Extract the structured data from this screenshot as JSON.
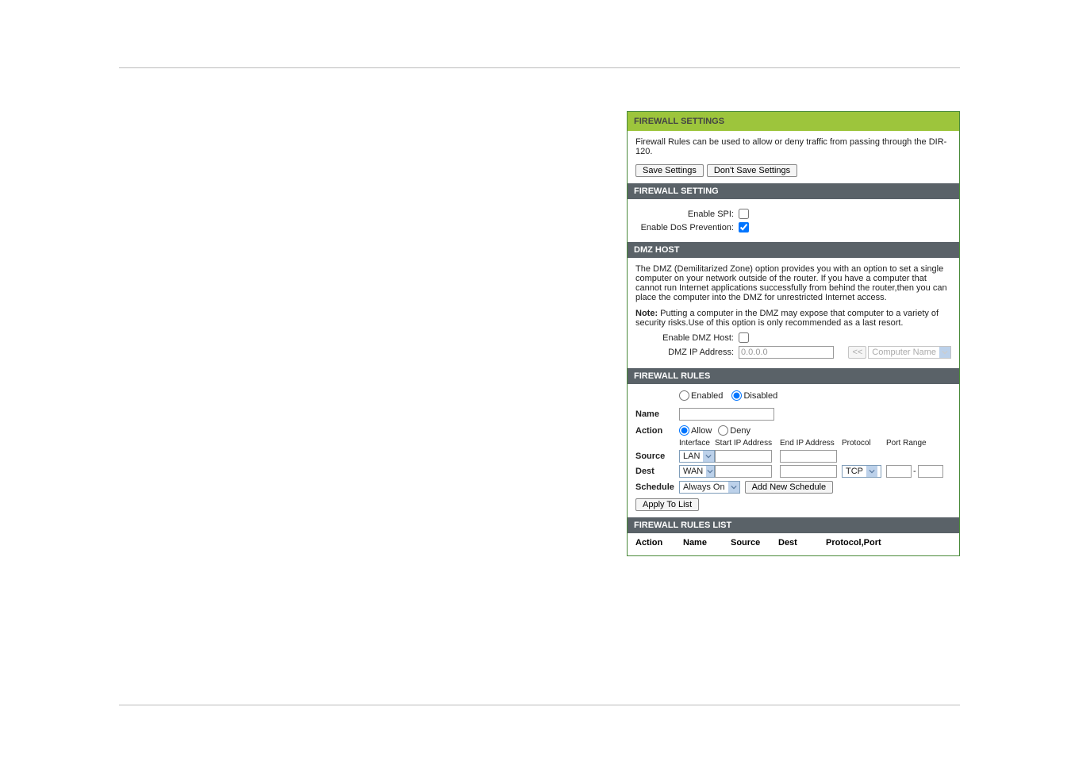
{
  "sections": {
    "title": "FIREWALL SETTINGS",
    "intro": "Firewall Rules can be used to allow or deny traffic from passing through the DIR-120.",
    "save": "Save Settings",
    "dontSave": "Don't Save Settings",
    "setting": {
      "header": "FIREWALL SETTING",
      "spiLabel": "Enable SPI:",
      "dosLabel": "Enable DoS Prevention:"
    },
    "dmz": {
      "header": "DMZ HOST",
      "desc": "The DMZ (Demilitarized Zone) option provides you with an option to set a single computer on your network outside of the router. If you have a computer that cannot run Internet applications successfully from behind the router,then you can place the computer into the DMZ for unrestricted Internet access.",
      "noteLabel": "Note:",
      "note": " Putting a computer in the DMZ may expose that computer to a variety of security risks.Use of this option is only recommended as a last resort.",
      "enableLabel": "Enable DMZ Host:",
      "ipLabel": "DMZ IP Address:",
      "ipValue": "0.0.0.0",
      "pullBtn": "<<",
      "compSelect": "Computer Name"
    },
    "rules": {
      "header": "FIREWALL RULES",
      "enabled": "Enabled",
      "disabled": "Disabled",
      "name": "Name",
      "action": "Action",
      "allow": "Allow",
      "deny": "Deny",
      "colInterface": "Interface",
      "colStart": "Start IP Address",
      "colEnd": "End IP Address",
      "colProtocol": "Protocol",
      "colPort": "Port Range",
      "source": "Source",
      "dest": "Dest",
      "lan": "LAN",
      "wan": "WAN",
      "tcp": "TCP",
      "schedule": "Schedule",
      "alwaysOn": "Always On",
      "addSchedule": "Add New Schedule",
      "apply": "Apply To List"
    },
    "list": {
      "header": "FIREWALL RULES LIST",
      "action": "Action",
      "name": "Name",
      "source": "Source",
      "dest": "Dest",
      "protocol": "Protocol,Port"
    }
  }
}
